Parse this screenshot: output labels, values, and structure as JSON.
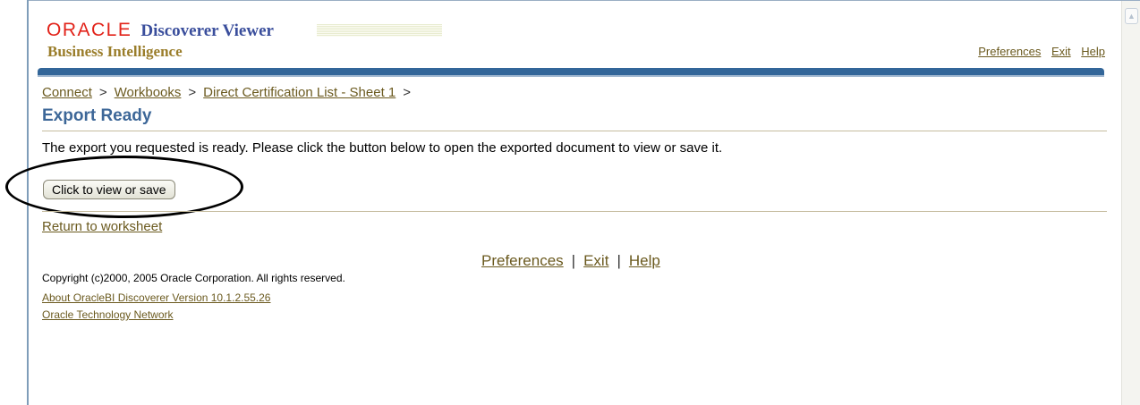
{
  "branding": {
    "oracle": "ORACLE",
    "product": "Discoverer Viewer",
    "suite": "Business Intelligence"
  },
  "global_links": [
    "Preferences",
    "Exit",
    "Help"
  ],
  "breadcrumb": [
    "Connect",
    "Workbooks",
    "Direct Certification List - Sheet 1"
  ],
  "breadcrumb_separator": ">",
  "page_title": "Export Ready",
  "message": "The export you requested is ready. Please click the button below to open the exported document to view or save it.",
  "button_label": "Click to view or save",
  "return_link": "Return to worksheet",
  "footer_links": [
    "Preferences",
    "Exit",
    "Help"
  ],
  "footer_separator": "|",
  "copyright": "Copyright (c)2000, 2005 Oracle Corporation. All rights reserved.",
  "about_link": "About OracleBI Discoverer Version 10.1.2.55.26",
  "otn_link": "Oracle Technology Network",
  "colors": {
    "brand_red": "#e2231a",
    "header_blue": "#336699",
    "link_brown": "#6b5a1f",
    "title_blue": "#3d6798"
  }
}
